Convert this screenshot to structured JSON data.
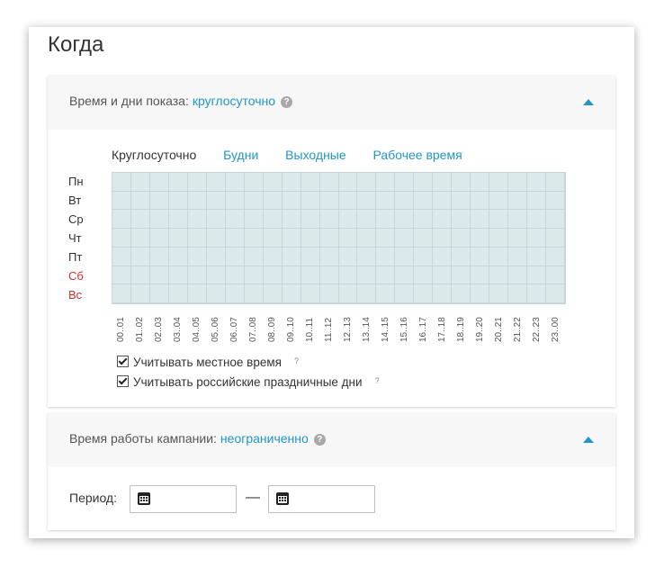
{
  "title": "Когда",
  "schedule": {
    "label": "Время и дни показа:",
    "value": "круглосуточно",
    "help": "?",
    "presets": [
      "Круглосуточно",
      "Будни",
      "Выходные",
      "Рабочее время"
    ],
    "days": [
      "Пн",
      "Вт",
      "Ср",
      "Чт",
      "Пт",
      "Сб",
      "Вс"
    ],
    "hours": [
      "00..01",
      "01..02",
      "02..03",
      "03..04",
      "04..05",
      "05..06",
      "06..07",
      "07..08",
      "08..09",
      "09..10",
      "10..11",
      "11..12",
      "12..13",
      "13..14",
      "14..15",
      "15..16",
      "16..17",
      "17..18",
      "18..19",
      "19..20",
      "20..21",
      "21..22",
      "22..23",
      "23..00"
    ],
    "local_time_label": "Учитывать местное время",
    "holidays_label": "Учитывать российские праздничные дни",
    "option_help": "?",
    "colors": {
      "accent": "#2196c8",
      "weekend": "#d03030",
      "grid_fill": "#dce9ea"
    }
  },
  "campaign": {
    "label": "Время работы кампании:",
    "value": "неограниченно",
    "help": "?",
    "period_label": "Период:",
    "dash": "—"
  }
}
